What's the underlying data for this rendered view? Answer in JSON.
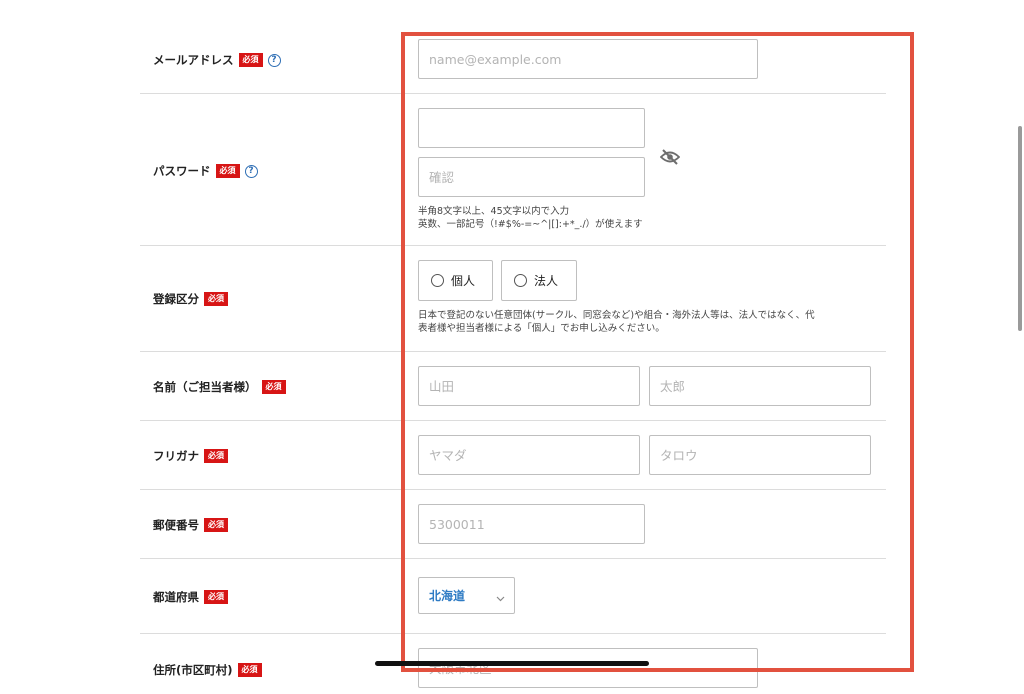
{
  "required_badge": "必須",
  "help_glyph": "?",
  "fields": {
    "email": {
      "label": "メールアドレス",
      "placeholder": "name@example.com"
    },
    "password": {
      "label": "パスワード",
      "confirm_placeholder": "確認",
      "note_line1": "半角8文字以上、45文字以内で入力",
      "note_line2": "英数、一部記号（!#$%-=~^|[]:+*_./）が使えます"
    },
    "registration_type": {
      "label": "登録区分",
      "options": [
        "個人",
        "法人"
      ],
      "note_line1": "日本で登記のない任意団体(サークル、同窓会など)や組合・海外法人等は、法人ではなく、代",
      "note_line2": "表者様や担当者様による「個人」でお申し込みください。"
    },
    "name": {
      "label": "名前（ご担当者様）",
      "last_placeholder": "山田",
      "first_placeholder": "太郎"
    },
    "furigana": {
      "label": "フリガナ",
      "last_placeholder": "ヤマダ",
      "first_placeholder": "タロウ"
    },
    "postal_code": {
      "label": "郵便番号",
      "placeholder": "5300011"
    },
    "prefecture": {
      "label": "都道府県",
      "selected": "北海道"
    },
    "city": {
      "label": "住所(市区町村)",
      "placeholder": "大阪市北区"
    }
  },
  "colors": {
    "required": "#d71515",
    "help": "#2f6fb5",
    "highlight": "#e2513f",
    "select_text": "#2e7bc4"
  },
  "icons": [
    "help-icon",
    "eye-slash-icon",
    "chevron-down-icon",
    "radio-circle-icon"
  ]
}
